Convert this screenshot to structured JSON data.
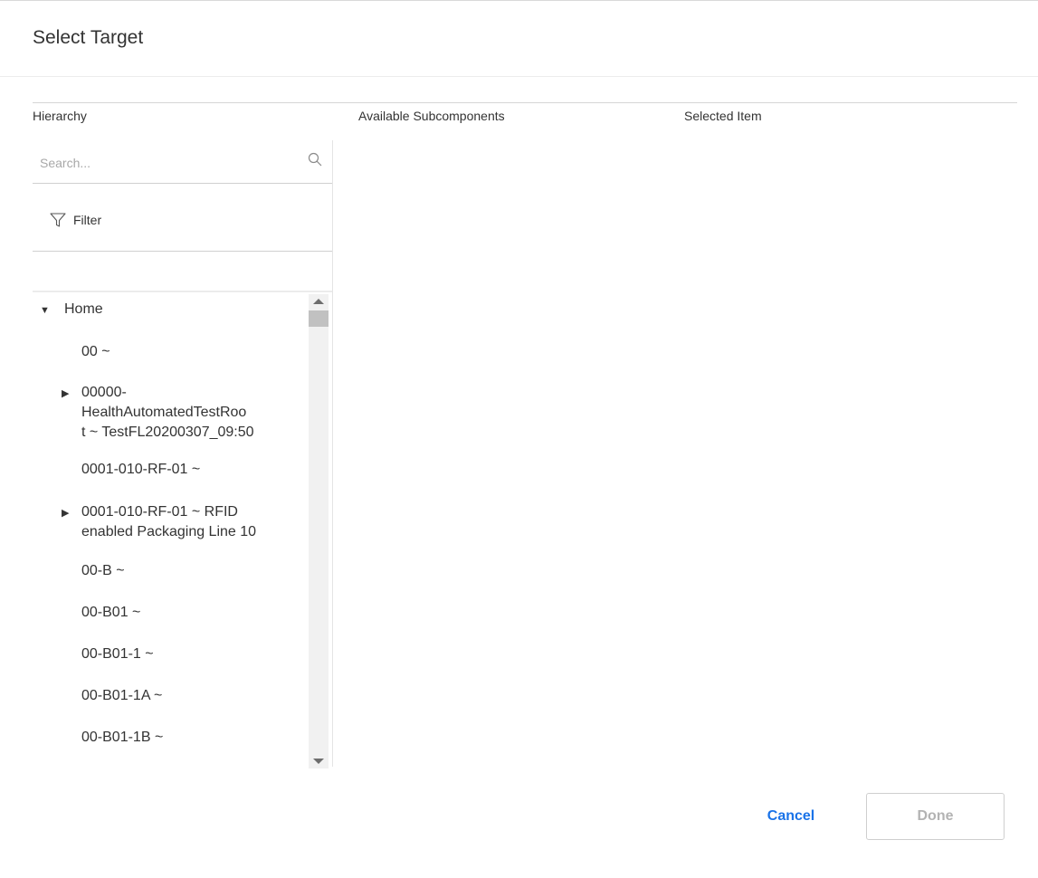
{
  "dialog": {
    "title": "Select Target"
  },
  "columns": {
    "hierarchy": "Hierarchy",
    "available": "Available Subcomponents",
    "selected": "Selected Item"
  },
  "search": {
    "placeholder": "Search..."
  },
  "filter": {
    "label": "Filter"
  },
  "tree": {
    "items": [
      {
        "text": "Home",
        "level": 0,
        "caret": "expanded"
      },
      {
        "text": "00 ~",
        "level": 1,
        "caret": "none"
      },
      {
        "text": "00000-\nHealthAutomatedTestRoo\nt ~ TestFL20200307_09:50",
        "level": 1,
        "caret": "collapsed"
      },
      {
        "text": "0001-010-RF-01 ~",
        "level": 1,
        "caret": "none"
      },
      {
        "text": "0001-010-RF-01 ~ RFID\nenabled Packaging Line 10",
        "level": 1,
        "caret": "collapsed"
      },
      {
        "text": "00-B ~",
        "level": 1,
        "caret": "none"
      },
      {
        "text": "00-B01 ~",
        "level": 1,
        "caret": "none"
      },
      {
        "text": "00-B01-1 ~",
        "level": 1,
        "caret": "none"
      },
      {
        "text": "00-B01-1A ~",
        "level": 1,
        "caret": "none"
      },
      {
        "text": "00-B01-1B ~",
        "level": 1,
        "caret": "none"
      }
    ]
  },
  "actions": {
    "cancel": "Cancel",
    "done": "Done"
  }
}
